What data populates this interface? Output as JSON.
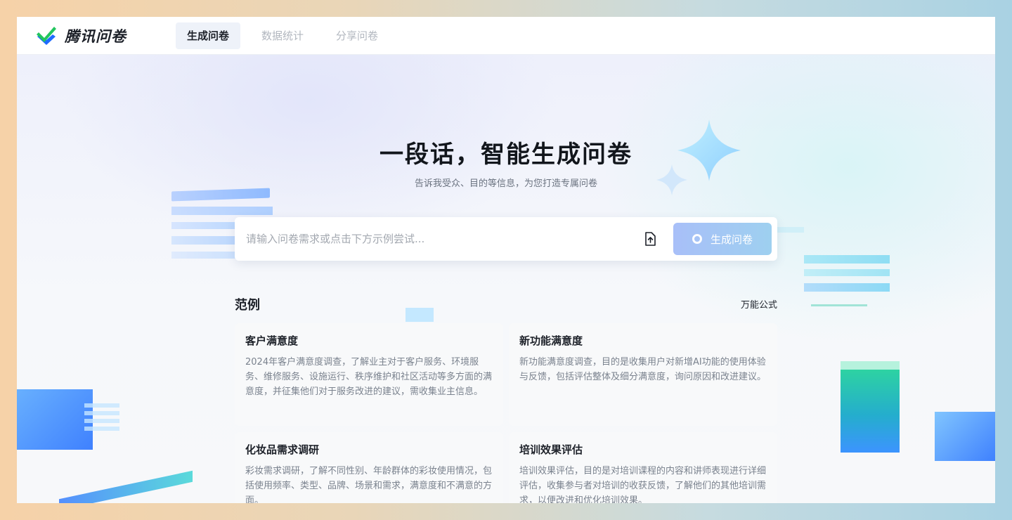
{
  "app": {
    "name": "腾讯问卷"
  },
  "nav": {
    "tabs": [
      {
        "label": "生成问卷",
        "active": true
      },
      {
        "label": "数据统计",
        "active": false
      },
      {
        "label": "分享问卷",
        "active": false
      }
    ]
  },
  "hero": {
    "title": "一段话，智能生成问卷",
    "subtitle": "告诉我受众、目的等信息，为您打造专属问卷"
  },
  "search": {
    "placeholder": "请输入问卷需求或点击下方示例尝试...",
    "value": "",
    "upload_icon": "upload-file-icon",
    "submit_label": "生成问卷"
  },
  "examples": {
    "heading": "范例",
    "formula_link": "万能公式",
    "cards": [
      {
        "title": "客户满意度",
        "desc": "2024年客户满意度调查，了解业主对于客户服务、环境服务、维修服务、设施运行、秩序维护和社区活动等多方面的满意度，并征集他们对于服务改进的建议，需收集业主信息。"
      },
      {
        "title": "新功能满意度",
        "desc": "新功能满意度调查，目的是收集用户对新增AI功能的使用体验与反馈，包括评估整体及细分满意度，询问原因和改进建议。"
      },
      {
        "title": "化妆品需求调研",
        "desc": "彩妆需求调研，了解不同性别、年龄群体的彩妆使用情况，包括使用频率、类型、品牌、场景和需求，满意度和不满意的方面。"
      },
      {
        "title": "培训效果评估",
        "desc": "培训效果评估，目的是对培训课程的内容和讲师表现进行详细评估，收集参与者对培训的收获反馈，了解他们的其他培训需求，以便改进和优化培训效果。"
      }
    ]
  },
  "colors": {
    "brand_green": "#22c55e",
    "brand_blue": "#1e6bff",
    "button_gradient_start": "#a8bff8",
    "button_gradient_end": "#9ed0f0"
  }
}
